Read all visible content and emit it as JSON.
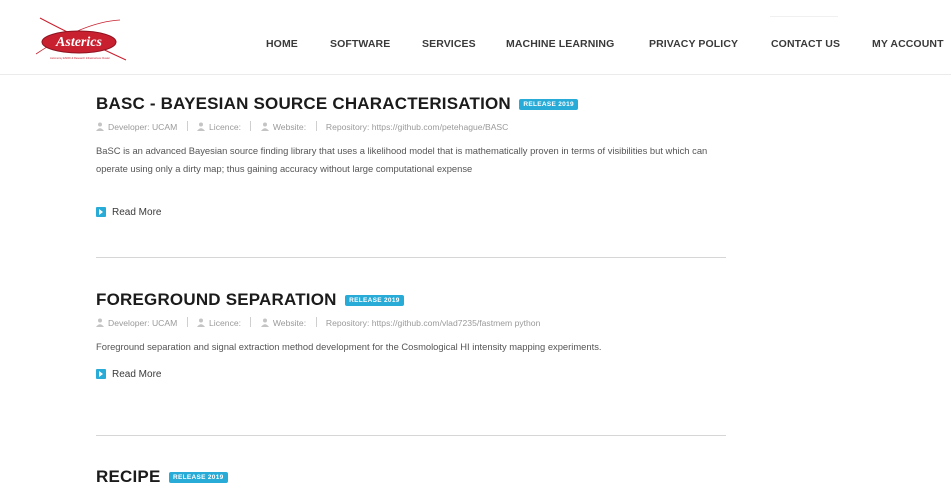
{
  "brand": {
    "name": "Asterics",
    "tagline": "Astronomy ESFRI & Research Infrastructure Cluster"
  },
  "nav": {
    "items": [
      {
        "label": "HOME"
      },
      {
        "label": "SOFTWARE"
      },
      {
        "label": "SERVICES"
      },
      {
        "label": "MACHINE LEARNING"
      },
      {
        "label": "PRIVACY POLICY"
      },
      {
        "label": "CONTACT US"
      },
      {
        "label": "MY ACCOUNT"
      }
    ]
  },
  "articles": [
    {
      "title": "BASC - BAYESIAN SOURCE CHARACTERISATION",
      "badge": "RELEASE 2019",
      "developer": "Developer: UCAM",
      "licence": "Licence:",
      "website": "Website:",
      "repository": "Repository: https://github.com/petehague/BASC",
      "description": "BaSC is an advanced Bayesian source finding library that uses a likelihood model that is mathematically proven in terms of visibilities but which can operate using only a dirty map; thus gaining accuracy without large computational expense",
      "read_more": "Read More"
    },
    {
      "title": "FOREGROUND SEPARATION",
      "badge": "RELEASE 2019",
      "developer": "Developer: UCAM",
      "licence": "Licence:",
      "website": "Website:",
      "repository": "Repository: https://github.com/vlad7235/fastmem python",
      "description": "Foreground separation and signal extraction method development for the Cosmological HI intensity mapping experiments.",
      "read_more": "Read More"
    },
    {
      "title": "RECIPE",
      "badge": "RELEASE 2019"
    }
  ],
  "colors": {
    "accent": "#29abd8",
    "brand_red": "#c8202f"
  }
}
